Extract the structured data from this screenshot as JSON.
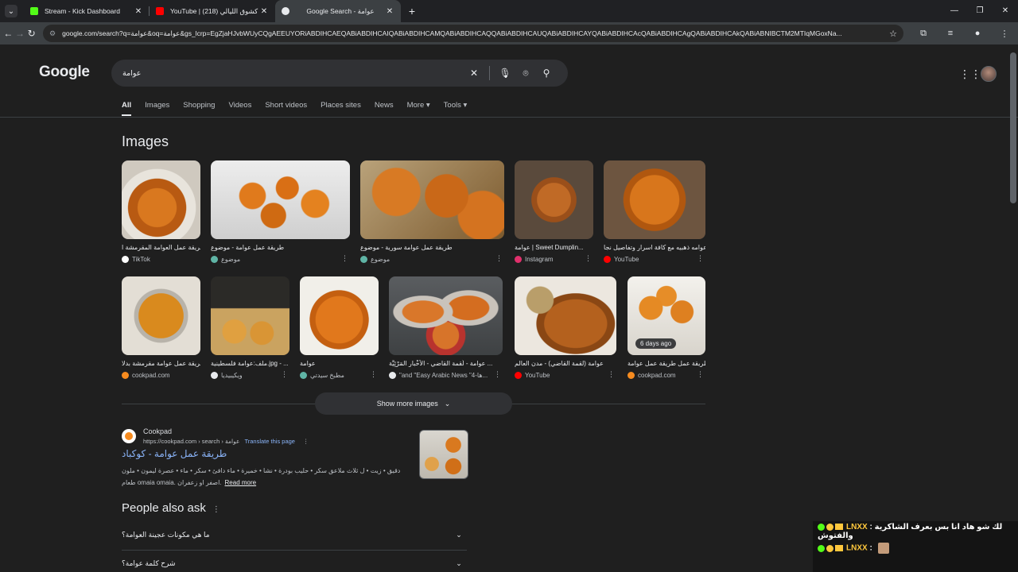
{
  "tabs": [
    {
      "title": "Stream - Kick Dashboard",
      "color": "#53fc18"
    },
    {
      "title": "YouTube | كشوق الليالي (218) ▸",
      "color": "#ff0000"
    },
    {
      "title": "Google Search - عوامة",
      "color": "#e8eaed"
    }
  ],
  "omnibox": {
    "url": "google.com/search?q=عوامة&oq=عوامة&gs_lcrp=EgZjaHJvbWUyCQgAEEUYORiABDIHCAEQABiABDIHCAIQABiABDIHCAMQABiABDIHCAQQABiABDIHCAUQABiABDIHCAYQABiABDIHCAcQABiABDIHCAgQABiABDIHCAkQABiABNIBCTM2MTIqMGoxNa..."
  },
  "google": {
    "logo": "Google",
    "query": "عوامة",
    "nav_tabs": [
      "All",
      "Images",
      "Shopping",
      "Videos",
      "Short videos",
      "Places sites",
      "News",
      "More ▾",
      "Tools ▾"
    ],
    "images_heading": "Images",
    "images": [
      {
        "caption": "طريقة عمل العوامة المقرمشة ا...",
        "source": "TikTok",
        "src_color": "#ffffff",
        "badge": ""
      },
      {
        "caption": "طريقة عمل عوامة - موضوع",
        "source": "موضوع",
        "src_color": "#5fb4a5",
        "badge": ""
      },
      {
        "caption": "طريقة عمل عوامة سورية - موضوع",
        "source": "موضوع",
        "src_color": "#5fb4a5",
        "badge": ""
      },
      {
        "caption": "عوامة | Sweet Dumplin...",
        "source": "Instagram",
        "src_color": "#e1306c",
        "badge": ""
      },
      {
        "caption": "عوامه ذهبيه مع كافة اسرار وتفاصيل نجا...",
        "source": "YouTube",
        "src_color": "#ff0000",
        "badge": ""
      },
      {
        "caption": "طريقة عمل عوامة مقرمشة بدلا...",
        "source": "cookpad.com",
        "src_color": "#f68b1f",
        "badge": ""
      },
      {
        "caption": "ملف:عوامة فلسطينية.jpg - ...",
        "source": "ويكيبيديا",
        "src_color": "#e8eaed",
        "badge": ""
      },
      {
        "caption": "عوامة",
        "source": "مطبخ سيدتي",
        "src_color": "#5fb4a5",
        "badge": ""
      },
      {
        "caption": "عوامة - لُقمة القاضي - الأَخْبار المَرْئِيَّة ...",
        "source": "\"and \"Easy Arabic News \"4-ها...",
        "src_color": "#e8eaed",
        "badge": ""
      },
      {
        "caption": "عوامة (لقمة القاضي) - مدن العالم",
        "source": "YouTube",
        "src_color": "#ff0000",
        "badge": ""
      },
      {
        "caption": "طريقة عمل طريقة عمل عوامة...",
        "source": "cookpad.com",
        "src_color": "#f68b1f",
        "badge": "6 days ago"
      }
    ],
    "show_more": "Show more images",
    "result": {
      "site": "Cookpad",
      "url": "https://cookpad.com › search › عوامة",
      "translate": "Translate this page",
      "title": "طريقة عمل عوامة - كوكباد",
      "snippet": "دقيق • زيت • ل ثلاث ملاعق سكر • حليب بودرة • نشا • خميرة • ماء دافئ • سكر • ماء • عصرة ليمون • ملون طعام omaia omaia. اصفر او زعفران.",
      "read_more": "Read more"
    },
    "paa_heading": "People also ask",
    "paa": [
      "ما هي مكونات عجينة العوامة؟",
      "شرح كلمة عوامة؟"
    ]
  },
  "chat": [
    {
      "user": "LNXX",
      "sub_count": "1",
      "message": "لك شو هاد انا بس بعرف الشاكرية والفتوش"
    },
    {
      "user": "LNXX",
      "sub_count": "1",
      "message": ""
    }
  ]
}
